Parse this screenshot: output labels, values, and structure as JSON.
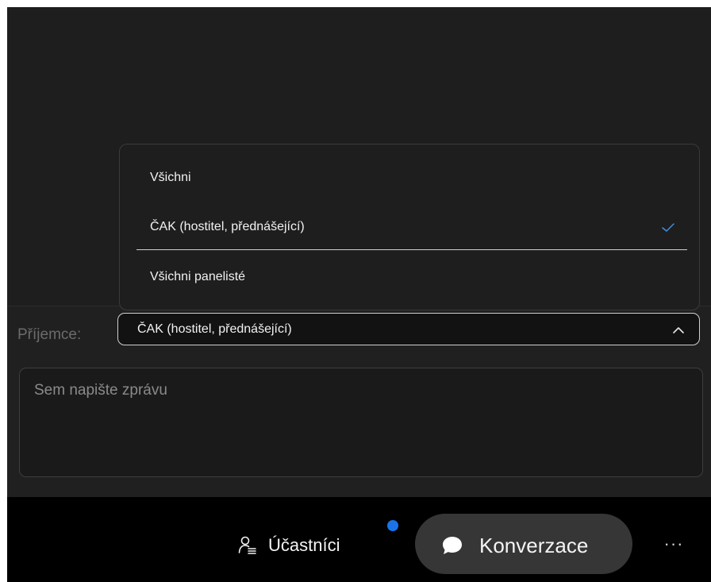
{
  "dropdown": {
    "items": [
      {
        "label": "Všichni"
      },
      {
        "label": "ČAK (hostitel, přednášející)",
        "selected": true
      },
      {
        "label": "Všichni panelisté"
      }
    ]
  },
  "recipient": {
    "label": "Příjemce:",
    "value": "ČAK (hostitel, přednášející)"
  },
  "message": {
    "placeholder": "Sem napište zprávu",
    "value": ""
  },
  "toolbar": {
    "participants_label": "Účastníci",
    "chat_label": "Konverzace",
    "more_label": "···",
    "notification_color": "#1a74e8"
  },
  "icons": {
    "participants": "person-list-icon",
    "chat": "chat-bubble-icon",
    "check": "checkmark-icon",
    "chevron": "chevron-up-icon"
  }
}
